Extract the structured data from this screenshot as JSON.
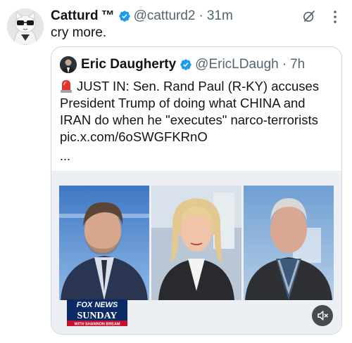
{
  "tweet": {
    "author_name": "Catturd",
    "author_tm": "™",
    "author_handle": "@catturd2",
    "separator": "·",
    "time": "31m",
    "text": "cry more."
  },
  "quote": {
    "author_name": "Eric Daugherty",
    "author_handle": "@EricLDaugh",
    "separator": "·",
    "time": "7h",
    "text_line1": "JUST IN: Sen. Rand Paul (R-KY) accuses",
    "text_line2": "President Trump of doing what CHINA and",
    "text_line3": "IRAN do when he \"executes\" narco-terrorists",
    "text_line4": "pic.x.com/6oSWGFKRnO",
    "ellipsis": "...",
    "emoji": "rotating-light-icon"
  },
  "media": {
    "network_logo_line1": "FOX NEWS",
    "network_logo_line2": "SUNDAY",
    "network_logo_line3": "WITH SHANNON BREAM"
  },
  "colors": {
    "verified_blue": "#1d9bf0",
    "secondary_text": "#536471",
    "border": "#cfd9de"
  }
}
